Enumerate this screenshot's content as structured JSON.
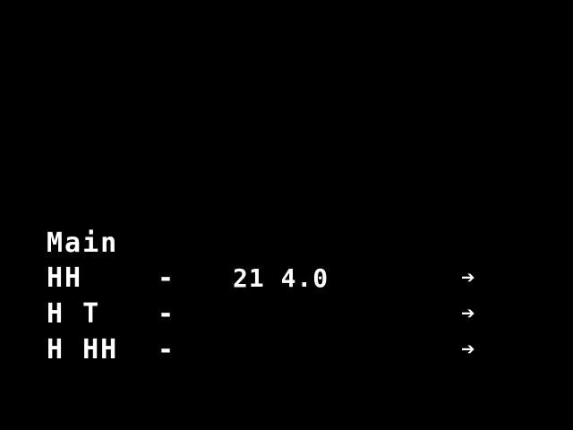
{
  "menu": {
    "title": "Main",
    "rows": [
      {
        "label": "HH",
        "separator": "-",
        "value": "21 4.0",
        "arrow_icon": "right-arrow-icon",
        "arrow": "➔"
      },
      {
        "label": "H T",
        "separator": "-",
        "value": "",
        "arrow_icon": "right-arrow-icon",
        "arrow": "➔"
      },
      {
        "label": "H HH",
        "separator": "-",
        "value": "",
        "arrow_icon": "right-arrow-icon",
        "arrow": "➔"
      }
    ]
  },
  "colors": {
    "background": "#000000",
    "text": "#ffffff"
  }
}
